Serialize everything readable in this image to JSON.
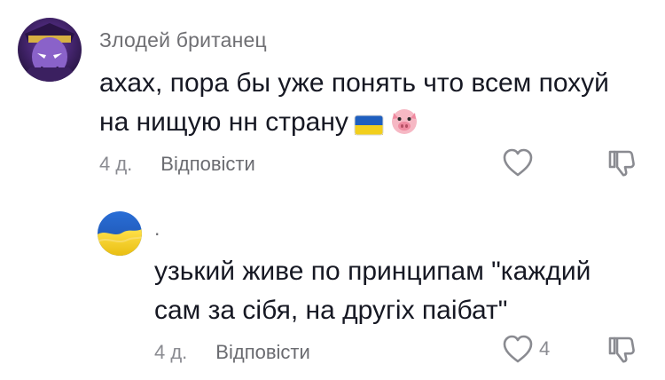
{
  "comments": [
    {
      "username": "Злодей британец",
      "text_lines": [
        "ахах, пора бы уже понять что всем похуй",
        "на нищую нн страну"
      ],
      "emojis": [
        "ukraine-flag-icon",
        "pig-face-icon"
      ],
      "time": "4 д.",
      "reply_label": "Відповісти",
      "likes": ""
    },
    {
      "username": ".",
      "text_lines": [
        "узький живе по принципам \"каждий",
        "сам за сібя, на другіх паібат\""
      ],
      "time": "4 д.",
      "reply_label": "Відповісти",
      "likes": "4"
    }
  ],
  "colors": {
    "text": "#161823",
    "muted": "#8a8b91",
    "flag_blue": "#1f5fbf",
    "flag_yellow": "#f2cf1d"
  }
}
